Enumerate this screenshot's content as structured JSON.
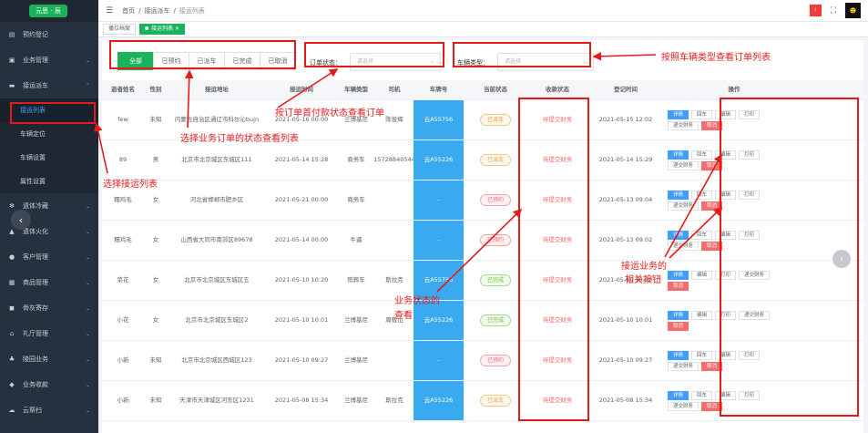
{
  "app": {
    "logo_text": "元思 · 辰"
  },
  "sidebar": {
    "items": [
      {
        "label": "预约登记",
        "icon": "clipboard-icon"
      },
      {
        "label": "业务管理",
        "icon": "briefcase-icon"
      },
      {
        "label": "接运派车",
        "icon": "car-icon"
      },
      {
        "label": "遗体冷藏",
        "icon": "snowflake-icon"
      },
      {
        "label": "遗体火化",
        "icon": "fire-icon"
      },
      {
        "label": "客户管理",
        "icon": "user-icon"
      },
      {
        "label": "商品管理",
        "icon": "cart-icon"
      },
      {
        "label": "骨灰寄存",
        "icon": "box-icon"
      },
      {
        "label": "礼厅管理",
        "icon": "hall-icon"
      },
      {
        "label": "陵园业务",
        "icon": "tree-icon"
      },
      {
        "label": "业务收款",
        "icon": "money-icon"
      },
      {
        "label": "云祭扫",
        "icon": "cloud-icon"
      }
    ],
    "submenu": [
      "接运列表",
      "车辆定位",
      "车辆设置",
      "属性设置"
    ]
  },
  "topbar": {
    "crumbs": [
      "首页",
      "接运派车",
      "接运列表"
    ],
    "alert_badge": "!",
    "fullscreen_glyph": "⛶",
    "avatar_text": "☻"
  },
  "tags": [
    "播位档案",
    "接运列表"
  ],
  "filters": {
    "buttons": [
      "全部",
      "已预约",
      "已派车",
      "已完成",
      "已取消"
    ],
    "status_label": "订单状态：",
    "status_placeholder": "请选择",
    "type_label": "车辆类型：",
    "type_placeholder": "请选择"
  },
  "table": {
    "headers": [
      "逝者姓名",
      "性别",
      "接运地址",
      "接运时间",
      "车辆类型",
      "司机",
      "车牌号",
      "当前状态",
      "收款状态",
      "登记时间",
      "操作"
    ],
    "rows": [
      {
        "name": "few",
        "sex": "未知",
        "addr": "内蒙古自治区通辽市科尔沁bujn",
        "time": "2021-05-16 00:00",
        "type": "兰博基尼",
        "driver": "陈俊辉",
        "plate": "云A55756",
        "status": "已派车",
        "st": "dispatched",
        "pay": "待提交财务",
        "reg": "2021-05-15 12:02"
      },
      {
        "name": "89",
        "sex": "男",
        "addr": "北京市北京城区东城区111",
        "time": "2021-05-14 15:28",
        "type": "商务车",
        "driver": "15728840544",
        "plate": "云A55226",
        "status": "已派车",
        "st": "dispatched",
        "pay": "待提交财务",
        "reg": "2021-05-14 15:29"
      },
      {
        "name": "糯鸡毛",
        "sex": "女",
        "addr": "河北省邯郸市肥乡区",
        "time": "2021-05-21 00:00",
        "type": "商务车",
        "driver": "",
        "plate": "-",
        "status": "已预约",
        "st": "booked",
        "pay": "待提交财务",
        "reg": "2021-05-13 09:04"
      },
      {
        "name": "糯鸡毛",
        "sex": "女",
        "addr": "山西省大同市南郊区89678",
        "time": "2021-05-14 00:00",
        "type": "牛逼",
        "driver": "",
        "plate": "-",
        "status": "已预约",
        "st": "booked",
        "pay": "待提交财务",
        "reg": "2021-05-13 09:02"
      },
      {
        "name": "菜花",
        "sex": "女",
        "addr": "北京市北京城区东城区五",
        "time": "2021-05-10 10:20",
        "type": "殡葬车",
        "driver": "斯拉克",
        "plate": "云A55756",
        "status": "已完成",
        "st": "done",
        "pay": "待提交财务",
        "reg": "2021-05-10 10:20"
      },
      {
        "name": "小花",
        "sex": "女",
        "addr": "北京市北京城区东城区2",
        "time": "2021-05-10 10:01",
        "type": "兰博基尼",
        "driver": "周敬山",
        "plate": "云A55226",
        "status": "已完成",
        "st": "done",
        "pay": "待提交财务",
        "reg": "2021-05-10 10:01"
      },
      {
        "name": "小新",
        "sex": "未知",
        "addr": "北京市北京城区西城区123",
        "time": "2021-05-10 09:27",
        "type": "兰博基尼",
        "driver": "",
        "plate": "-",
        "status": "已预约",
        "st": "booked",
        "pay": "待提交财务",
        "reg": "2021-05-10 09:27"
      },
      {
        "name": "小新",
        "sex": "未知",
        "addr": "天津市天津城区河东区1231",
        "time": "2021-05-08 15:34",
        "type": "兰博基尼",
        "driver": "斯拉克",
        "plate": "云A55226",
        "status": "已派车",
        "st": "dispatched",
        "pay": "待提交财务",
        "reg": "2021-05-08 15:34"
      }
    ],
    "ops_full": [
      "详情",
      "回车",
      "编辑",
      "打印",
      "递交财务",
      "取消"
    ],
    "ops_done": [
      "详情",
      "编辑",
      "打印",
      "递交财务",
      "取消"
    ]
  },
  "annotations": {
    "filter_buttons": "选择业务订单的状态查看列表",
    "order_status": "按订单首付款状态查看订单",
    "vehicle_type": "按照车辆类型查看订单列表",
    "select_list": "选择接运列表",
    "status_view_1": "业务状态的",
    "status_view_2": "查看",
    "ops_1": "接运业务的",
    "ops_2": "相关按钮"
  }
}
